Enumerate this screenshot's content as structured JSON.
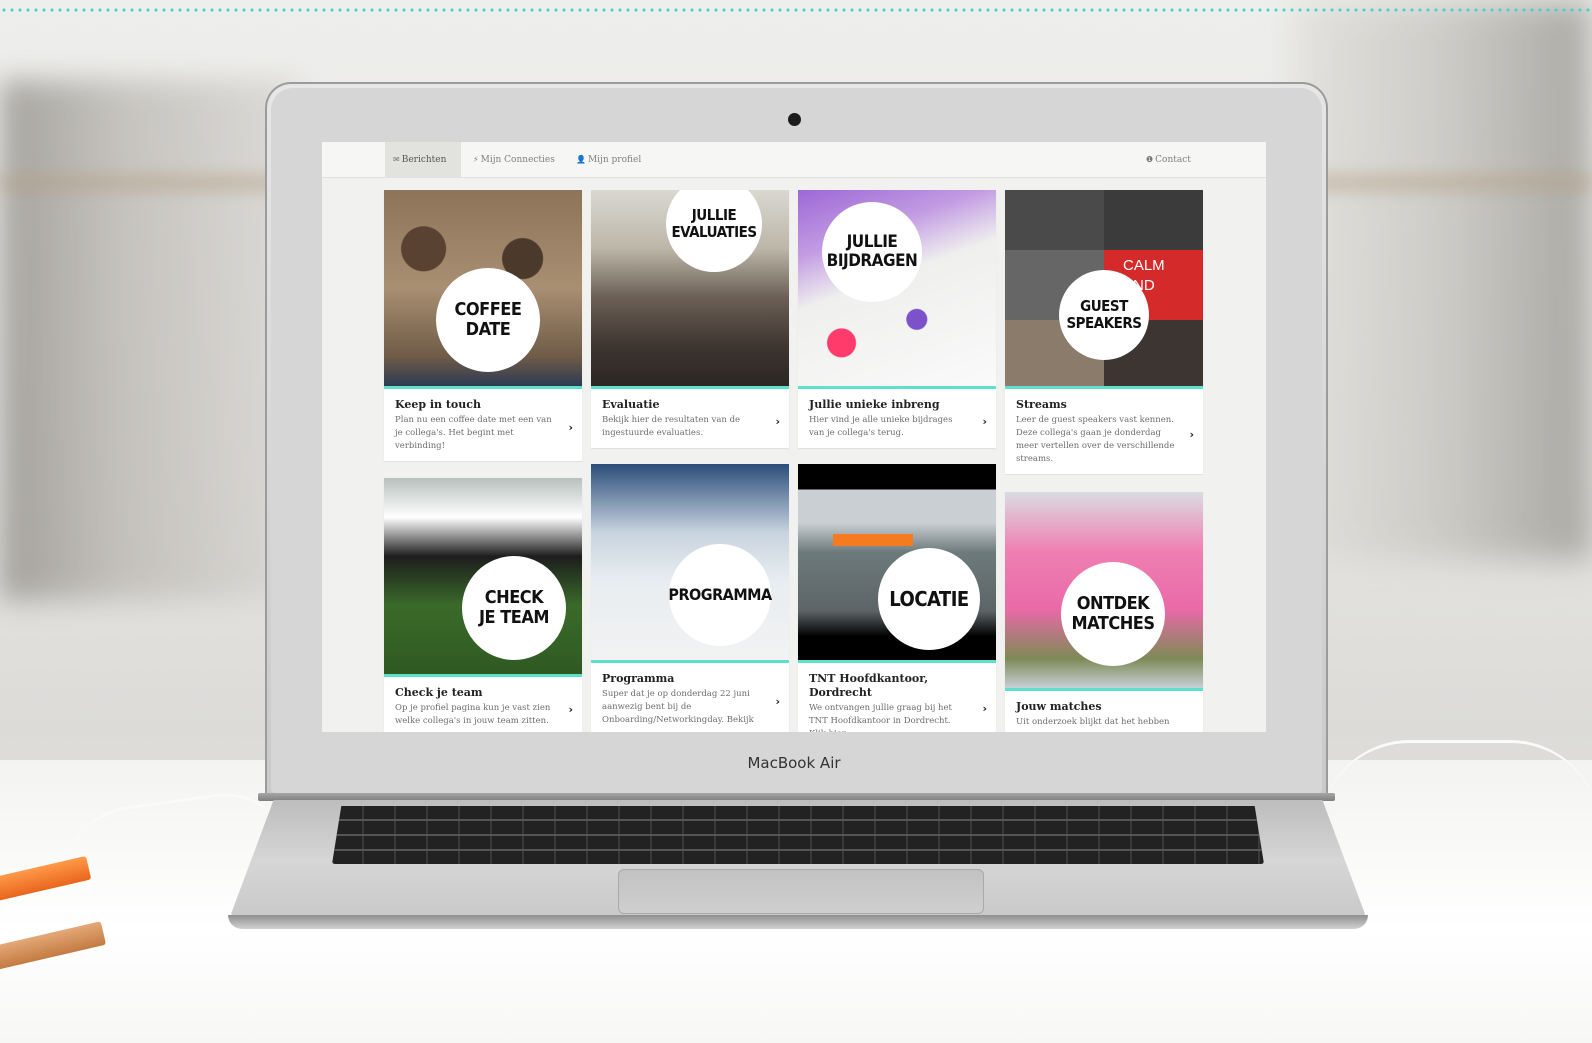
{
  "device": {
    "brand_label": "MacBook Air"
  },
  "colors": {
    "accent": "#5fe0cb",
    "dotted_rule": "#3fd6c8"
  },
  "nav": {
    "items": [
      {
        "icon": "envelope-icon",
        "glyph": "✉",
        "label": "Berichten",
        "active": true
      },
      {
        "icon": "bolt-icon",
        "glyph": "⚡",
        "label": "Mijn Connecties",
        "active": false
      },
      {
        "icon": "user-icon",
        "glyph": "👤",
        "label": "Mijn profiel",
        "active": false
      }
    ],
    "contact": {
      "icon": "info-icon",
      "glyph": "❶",
      "label": "Contact"
    }
  },
  "tiles": [
    {
      "circle": "COFFEE\nDATE",
      "title": "Keep in touch",
      "desc": "Plan nu een coffee date met een van je collega's. Het begint met verbinding!"
    },
    {
      "circle": "JULLIE\nEVALUATIES",
      "title": "Evaluatie",
      "desc": "Bekijk hier de resultaten van de ingestuurde evaluaties."
    },
    {
      "circle": "JULLIE\nBIJDRAGEN",
      "title": "Jullie unieke inbreng",
      "desc": "Hier vind je alle unieke bijdrages van je collega's terug."
    },
    {
      "circle": "GUEST\nSPEAKERS",
      "title": "Streams",
      "desc": "Leer de guest speakers vast kennen. Deze collega's gaan je donderdag meer vertellen over de verschillende streams."
    },
    {
      "circle": "CHECK\nJE TEAM",
      "title": "Check je team",
      "desc": "Op je profiel pagina kun je vast zien welke collega's in jouw team zitten."
    },
    {
      "circle": "PROGRAMMA",
      "title": "Programma",
      "desc": "Super dat je op donderdag 22 juni aanwezig bent bij de Onboarding/Networkingday. Bekijk"
    },
    {
      "circle": "LOCATIE",
      "title": "TNT Hoofdkantoor, Dordrecht",
      "desc": "We ontvangen jullie graag bij het TNT Hoofdkantoor in Dordrecht. Klik hier"
    },
    {
      "circle": "ONTDEK\nMATCHES",
      "title": "Jouw matches",
      "desc": "Uit onderzoek blijkt dat het hebben"
    }
  ],
  "photo_texts": {
    "guest_poster": "CALM\nAND\nBE"
  }
}
